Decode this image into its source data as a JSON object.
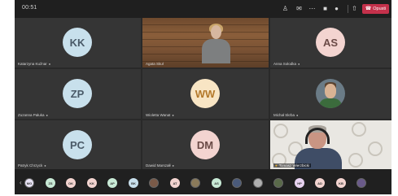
{
  "topbar": {
    "clock": "00:51",
    "leave_label": "Opusti",
    "icons": [
      "people-icon",
      "chat-icon",
      "more-icon",
      "camera-icon",
      "mic-icon",
      "share-icon",
      "phone-icon"
    ]
  },
  "tiles": [
    {
      "id": "kk",
      "initials": "KK",
      "name": "Katarzyna Kuźnar",
      "avatar_bg": "#c8e0ec",
      "avatar_fg": "#4a5a68"
    },
    {
      "id": "video1",
      "name": "Agata Skuł"
    },
    {
      "id": "as",
      "initials": "AS",
      "name": "Anna Sołodka",
      "avatar_bg": "#f3d4d0",
      "avatar_fg": "#6a4a46"
    },
    {
      "id": "zp",
      "initials": "ZP",
      "name": "Zuzanna Pałuka",
      "avatar_bg": "#c8e0ec",
      "avatar_fg": "#4a5a68"
    },
    {
      "id": "ww",
      "initials": "WW",
      "name": "Wioletta Wanat",
      "avatar_bg": "#f8e5c4",
      "avatar_fg": "#b4792b"
    },
    {
      "id": "photo",
      "name": "Michał Skrba"
    },
    {
      "id": "pc",
      "initials": "PC",
      "name": "Patryk Chrzyck",
      "avatar_bg": "#c8e0ec",
      "avatar_fg": "#4a5a68"
    },
    {
      "id": "dm",
      "initials": "DM",
      "name": "Dawid Marszałł",
      "avatar_bg": "#f3d4d0",
      "avatar_fg": "#6a4a46"
    },
    {
      "id": "self",
      "name": "Tomasz Wierzbicki"
    }
  ],
  "strip": [
    {
      "label": "MG",
      "bg": "#e8e3f5",
      "photo": true
    },
    {
      "label": "ZS",
      "bg": "#c8ead6"
    },
    {
      "label": "OK",
      "bg": "#f3d4d0"
    },
    {
      "label": "KK",
      "bg": "#f3d4d0"
    },
    {
      "label": "AP",
      "bg": "#c8ead6"
    },
    {
      "label": "BK",
      "bg": "#c8e0ec"
    },
    {
      "label": "",
      "bg": "#7a5a48",
      "photo": true
    },
    {
      "label": "AT",
      "bg": "#f3d4d0"
    },
    {
      "label": "",
      "bg": "#8a7a5a",
      "photo": true
    },
    {
      "label": "AS",
      "bg": "#c8ead6"
    },
    {
      "label": "",
      "bg": "#4a5a7a",
      "photo": true
    },
    {
      "label": "",
      "bg": "#b0b0b0",
      "photo": true
    },
    {
      "label": "",
      "bg": "#5a6a4a",
      "photo": true
    },
    {
      "label": "HP",
      "bg": "#e8d3f0"
    },
    {
      "label": "AD",
      "bg": "#f3d4d0"
    },
    {
      "label": "KB",
      "bg": "#f3d4d0"
    },
    {
      "label": "",
      "bg": "#6a5a8a",
      "photo": true
    }
  ]
}
